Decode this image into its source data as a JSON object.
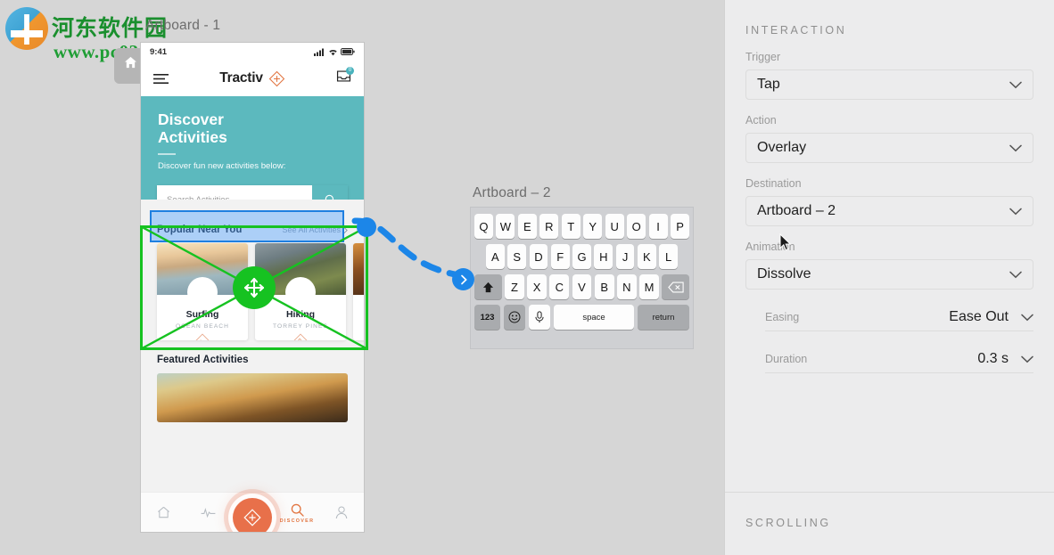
{
  "watermark": {
    "cn": "河东软件园",
    "url": "www.pc0359.cn"
  },
  "canvas": {
    "artboard1_label": "Artboard - 1",
    "artboard2_label": "Artboard – 2",
    "home_icon": "home-icon"
  },
  "phone": {
    "status": {
      "time": "9:41",
      "signal_icon": "signal-icon",
      "wifi_icon": "wifi-icon",
      "battery_icon": "battery-icon"
    },
    "appbar": {
      "menu_icon": "hamburger-menu-icon",
      "brand": "Tractiv",
      "brand_icon": "diamond-logo-icon",
      "inbox_icon": "inbox-icon",
      "inbox_badge": "0"
    },
    "hero": {
      "title_line1": "Discover",
      "title_line2": "Activities",
      "subtitle": "Discover fun new activities below:",
      "bg_color": "#5cb9be"
    },
    "search": {
      "placeholder": "Search Activities",
      "button_icon": "search-icon"
    },
    "popular": {
      "title": "Popular Near You",
      "link": "See All Activities",
      "link_icon": "chevron-right-icon",
      "cards": [
        {
          "name": "Surfing",
          "location": "OCEAN BEACH",
          "badge_icon": "wave-badge-icon"
        },
        {
          "name": "Hiking",
          "location": "TORREY PINES",
          "badge_icon": "mountain-badge-icon"
        },
        {
          "name": "",
          "location": "",
          "badge_icon": ""
        }
      ]
    },
    "featured": {
      "title": "Featured Activities"
    },
    "tabbar": {
      "items": [
        {
          "icon": "home-icon",
          "label": ""
        },
        {
          "icon": "activity-pulse-icon",
          "label": ""
        },
        {
          "icon": "diamond-plus-icon",
          "label": ""
        },
        {
          "icon": "search-icon",
          "label": "DISCOVER"
        },
        {
          "icon": "person-icon",
          "label": ""
        }
      ],
      "active_color": "#e2743f"
    }
  },
  "keyboard": {
    "row1": [
      "Q",
      "W",
      "E",
      "R",
      "T",
      "Y",
      "U",
      "O",
      "I",
      "P"
    ],
    "row2": [
      "A",
      "S",
      "D",
      "F",
      "G",
      "H",
      "J",
      "K",
      "L"
    ],
    "row3": [
      "Z",
      "X",
      "C",
      "V",
      "B",
      "N",
      "M"
    ],
    "shift_icon": "shift-arrow-icon",
    "backspace_icon": "backspace-icon",
    "num_key": "123",
    "emoji_icon": "emoji-smiley-icon",
    "mic_icon": "microphone-icon",
    "space_key": "space",
    "return_key": "return"
  },
  "selection": {
    "blue_color": "#1f7fe0",
    "green_color": "#16c221",
    "move_icon": "move-handle-icon",
    "connector_icon": "chevron-right-circle-icon"
  },
  "panel": {
    "interaction_title": "INTERACTION",
    "fields": [
      {
        "label": "Trigger",
        "value": "Tap"
      },
      {
        "label": "Action",
        "value": "Overlay"
      },
      {
        "label": "Destination",
        "value": "Artboard – 2"
      },
      {
        "label": "Animation",
        "value": "Dissolve"
      }
    ],
    "sub_fields": [
      {
        "label": "Easing",
        "value": "Ease Out"
      },
      {
        "label": "Duration",
        "value": "0.3 s"
      }
    ],
    "scrolling_title": "SCROLLING",
    "chevron_icon": "chevron-down-icon"
  }
}
